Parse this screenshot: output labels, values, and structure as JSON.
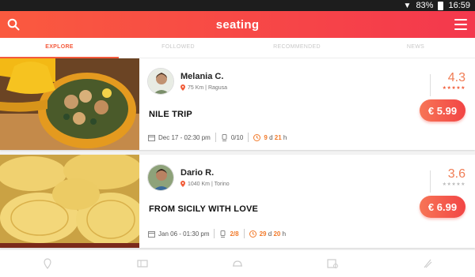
{
  "status_bar": {
    "battery": "83%",
    "time": "16:59"
  },
  "app": {
    "brand": "seating"
  },
  "tabs": [
    {
      "label": "EXPLORE",
      "active": true
    },
    {
      "label": "FOLLOWED",
      "active": false
    },
    {
      "label": "RECOMMENDED",
      "active": false
    },
    {
      "label": "NEWS",
      "active": false
    }
  ],
  "events": [
    {
      "host_name": "Melania C.",
      "location": "75 Km | Ragusa",
      "title": "NILE TRIP",
      "date": "Dec 17 - 02:30 pm",
      "seats": "0/10",
      "countdown_days": "9",
      "countdown_d": "d",
      "countdown_hours": "21",
      "countdown_h": "h",
      "rating": "4.3",
      "stars": "★★★★★",
      "price": "€ 5.99"
    },
    {
      "host_name": "Dario R.",
      "location": "1040 Km | Torino",
      "title": "FROM SICILY WITH LOVE",
      "date": "Jan 06 - 01:30 pm",
      "seats": "2/8",
      "countdown_days": "29",
      "countdown_d": "d",
      "countdown_hours": "20",
      "countdown_h": "h",
      "rating": "3.6",
      "stars": "★★★★★",
      "price": "€ 6.99"
    }
  ],
  "colors": {
    "accent": "#f45a3c",
    "brand_gradient_start": "#fa5a3f",
    "brand_gradient_end": "#f4384d"
  },
  "bottom_nav": [
    "pin-icon",
    "ticket-icon",
    "dish-icon",
    "calendar-icon",
    "chef-icon"
  ]
}
